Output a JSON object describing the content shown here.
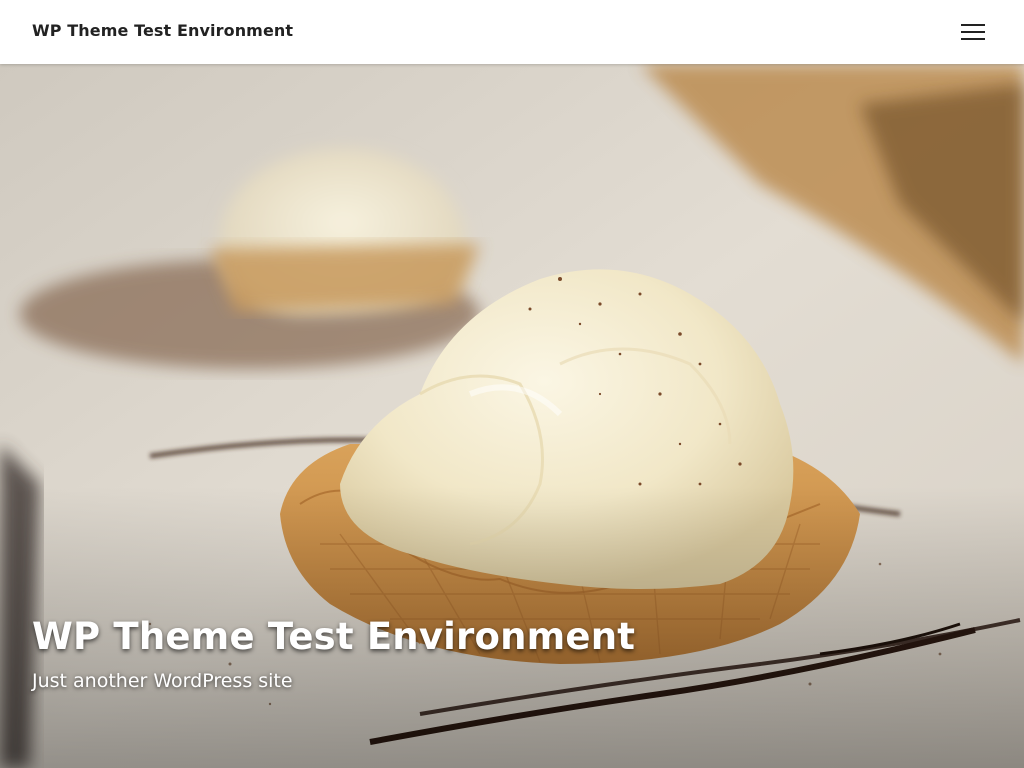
{
  "header": {
    "site_title": "WP Theme Test Environment",
    "menu_icon": "hamburger-menu-icon"
  },
  "hero": {
    "title": "WP Theme Test Environment",
    "tagline": "Just another WordPress site",
    "image_subject": "ice cream scoop in waffle cup on plate"
  },
  "colors": {
    "header_bg": "#ffffff",
    "title_text": "#222222",
    "hero_text": "#ffffff"
  }
}
